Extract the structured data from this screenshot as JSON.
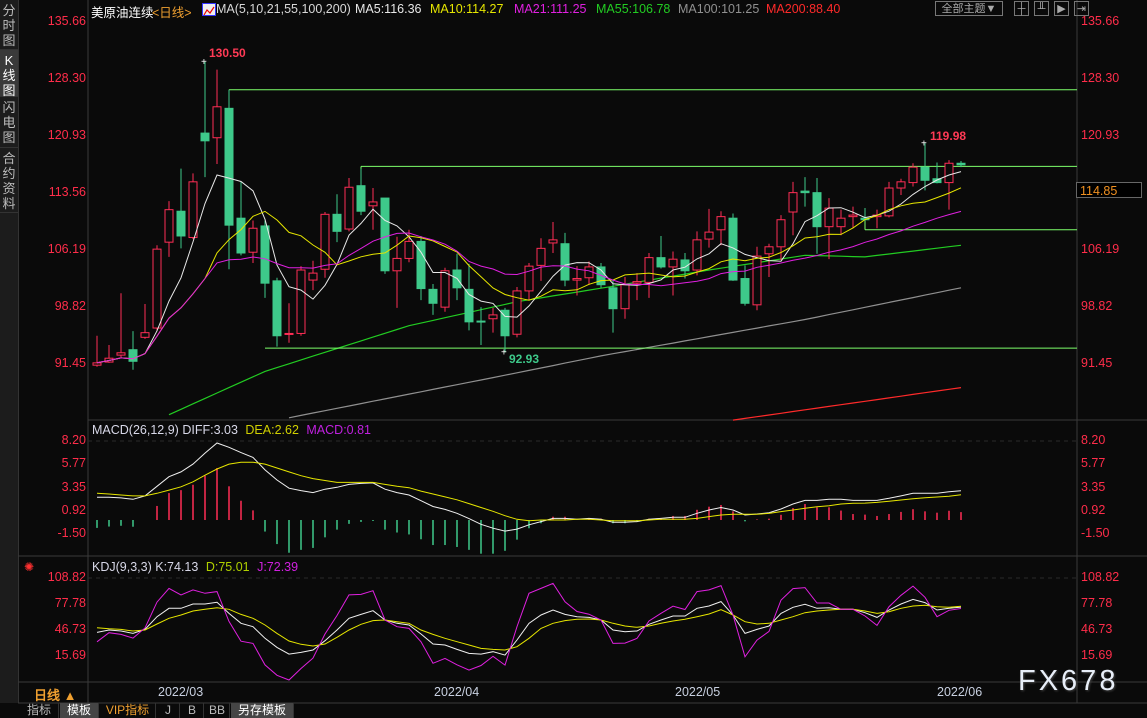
{
  "sidebar": {
    "tabs": [
      {
        "label": "分时图",
        "active": false
      },
      {
        "label": "K线图",
        "active": true
      },
      {
        "label": "闪电图",
        "active": false
      },
      {
        "label": "合约资料",
        "active": false
      }
    ]
  },
  "header": {
    "instrument": "美原油连续",
    "period": "<日线>",
    "ma_label": "MA(5,10,21,55,100,200)",
    "ma5": "MA5:116.36",
    "ma10": "MA10:114.27",
    "ma21": "MA21:111.25",
    "ma55": "MA55:106.78",
    "ma100": "MA100:101.25",
    "ma200": "MA200:88.40",
    "theme_button": "全部主题▼",
    "colors": {
      "ma5": "#e8e8e8",
      "ma10": "#e6e600",
      "ma21": "#e020e0",
      "ma55": "#22cc22",
      "ma100": "#909090",
      "ma200": "#ff2a2a"
    }
  },
  "macd_header": {
    "label": "MACD(26,12,9)",
    "diff": "DIFF:3.03",
    "dea": "DEA:2.62",
    "macd": "MACD:0.81"
  },
  "kdj_header": {
    "label": "KDJ(9,3,3)",
    "k": "K:74.13",
    "d": "D:75.01",
    "j": "J:72.39"
  },
  "price_axis": [
    "135.66",
    "128.30",
    "120.93",
    "113.56",
    "106.19",
    "98.82",
    "91.45"
  ],
  "macd_axis": [
    "8.20",
    "5.77",
    "3.35",
    "0.92",
    "-1.50"
  ],
  "kdj_axis": [
    "108.82",
    "77.78",
    "46.73",
    "15.69"
  ],
  "current_price": "114.85",
  "high_label": "130.50",
  "low_label": "92.93",
  "recent_high_label": "119.98",
  "period_selector": "日线 ▲",
  "dates": [
    "2022/03",
    "2022/04",
    "2022/05",
    "2022/06"
  ],
  "bottom_tabs": [
    {
      "label": "指标",
      "active": false
    },
    {
      "label": "模板",
      "active": true
    },
    {
      "label": "VIP指标",
      "active": false
    },
    {
      "label": "J",
      "active": false
    },
    {
      "label": "B",
      "active": false
    },
    {
      "label": "BB",
      "active": false
    },
    {
      "label": "另存模板",
      "active": true
    }
  ],
  "watermark": "FX678",
  "colors": {
    "up": "#ff2d55",
    "down": "#3ec98a",
    "annotation": "#7dff6a"
  },
  "chart_data": {
    "type": "candlestick",
    "title": "美原油连续 日线",
    "price_range": [
      91.45,
      135.66
    ],
    "ohlc": [
      [
        91.3,
        95.1,
        91.1,
        91.6
      ],
      [
        91.7,
        93.9,
        91.6,
        92.2
      ],
      [
        92.6,
        100.6,
        92.3,
        92.9
      ],
      [
        93.3,
        95.7,
        90.7,
        91.8
      ],
      [
        94.9,
        99.2,
        94.7,
        95.5
      ],
      [
        96.1,
        106.8,
        95.7,
        106.3
      ],
      [
        107.2,
        112.5,
        105.3,
        111.4
      ],
      [
        111.2,
        116.7,
        106.4,
        108.0
      ],
      [
        107.8,
        116.1,
        107.6,
        115.0
      ],
      [
        121.3,
        130.5,
        115.6,
        120.3
      ],
      [
        120.7,
        129.5,
        117.3,
        124.7
      ],
      [
        124.5,
        126.9,
        103.7,
        109.4
      ],
      [
        110.3,
        115.0,
        105.5,
        105.8
      ],
      [
        105.9,
        110.0,
        104.5,
        109.0
      ],
      [
        109.3,
        110.0,
        100.0,
        101.9
      ],
      [
        102.2,
        102.6,
        93.7,
        95.1
      ],
      [
        95.3,
        99.3,
        94.2,
        95.4
      ],
      [
        95.4,
        104.1,
        95.1,
        103.6
      ],
      [
        102.3,
        104.8,
        101.0,
        103.2
      ],
      [
        103.7,
        111.1,
        102.6,
        110.8
      ],
      [
        110.8,
        113.4,
        107.2,
        108.6
      ],
      [
        108.9,
        115.5,
        108.6,
        114.3
      ],
      [
        114.5,
        116.7,
        110.7,
        111.2
      ],
      [
        111.9,
        114.2,
        108.8,
        112.4
      ],
      [
        112.9,
        112.9,
        103.1,
        103.5
      ],
      [
        103.5,
        107.9,
        98.7,
        105.1
      ],
      [
        105.1,
        108.8,
        104.6,
        107.3
      ],
      [
        107.3,
        108.0,
        99.7,
        101.2
      ],
      [
        101.1,
        101.8,
        97.8,
        99.3
      ],
      [
        98.8,
        103.9,
        98.2,
        103.5
      ],
      [
        103.6,
        105.7,
        99.7,
        101.3
      ],
      [
        101.1,
        104.4,
        95.8,
        96.9
      ],
      [
        97.0,
        98.8,
        93.9,
        96.9
      ],
      [
        97.3,
        98.7,
        95.5,
        97.8
      ],
      [
        98.4,
        98.7,
        92.93,
        95.1
      ],
      [
        95.3,
        101.4,
        94.9,
        100.9
      ],
      [
        100.9,
        104.5,
        99.7,
        104.1
      ],
      [
        104.2,
        107.7,
        102.2,
        106.4
      ],
      [
        107.1,
        109.8,
        105.8,
        107.5
      ],
      [
        107.0,
        108.4,
        101.5,
        102.3
      ],
      [
        102.3,
        104.1,
        100.3,
        102.5
      ],
      [
        102.6,
        104.7,
        101.7,
        104.0
      ],
      [
        104.0,
        104.5,
        101.3,
        101.7
      ],
      [
        101.3,
        102.3,
        95.5,
        98.6
      ],
      [
        98.6,
        102.7,
        97.3,
        101.7
      ],
      [
        101.9,
        103.2,
        99.7,
        102.1
      ],
      [
        102.0,
        105.8,
        100.0,
        105.2
      ],
      [
        105.2,
        108.0,
        103.8,
        104.0
      ],
      [
        104.0,
        106.0,
        100.3,
        105.0
      ],
      [
        104.9,
        105.8,
        102.5,
        103.5
      ],
      [
        103.6,
        108.6,
        102.9,
        107.5
      ],
      [
        107.6,
        111.5,
        106.5,
        108.5
      ],
      [
        108.8,
        111.2,
        106.8,
        110.5
      ],
      [
        110.3,
        110.9,
        102.2,
        102.3
      ],
      [
        102.5,
        104.2,
        99.0,
        99.3
      ],
      [
        99.1,
        106.6,
        98.4,
        105.4
      ],
      [
        105.7,
        107.0,
        102.7,
        106.6
      ],
      [
        106.6,
        110.7,
        104.9,
        110.1
      ],
      [
        111.1,
        115.0,
        108.1,
        113.6
      ],
      [
        113.8,
        115.6,
        111.8,
        113.6
      ],
      [
        113.6,
        115.5,
        105.7,
        109.2
      ],
      [
        109.2,
        112.9,
        105.0,
        111.6
      ],
      [
        109.2,
        111.4,
        108.1,
        110.3
      ],
      [
        110.5,
        111.8,
        109.0,
        110.7
      ],
      [
        110.3,
        111.6,
        109.9,
        110.1
      ],
      [
        110.5,
        111.4,
        109.0,
        110.7
      ],
      [
        110.6,
        115.0,
        110.4,
        114.2
      ],
      [
        114.2,
        115.4,
        113.3,
        115.0
      ],
      [
        114.9,
        117.4,
        114.4,
        116.9
      ],
      [
        116.9,
        119.98,
        113.9,
        115.2
      ],
      [
        115.4,
        117.5,
        114.8,
        114.9
      ],
      [
        114.9,
        117.8,
        111.4,
        117.4
      ],
      [
        117.4,
        117.7,
        116.9,
        117.2
      ]
    ],
    "ma_long": {
      "ma55": [
        [
          6,
          84.9
        ],
        [
          14,
          90.5
        ],
        [
          26,
          96.4
        ],
        [
          35,
          99.5
        ],
        [
          43,
          101.5
        ],
        [
          51,
          103.6
        ],
        [
          59,
          105.5
        ],
        [
          64,
          105.3
        ],
        [
          72,
          106.8
        ]
      ],
      "ma100": [
        [
          16,
          84.5
        ],
        [
          34,
          90.0
        ],
        [
          42,
          92.5
        ],
        [
          59,
          97.2
        ],
        [
          72,
          101.3
        ]
      ],
      "ma200": [
        [
          53,
          84.2
        ],
        [
          72,
          88.4
        ]
      ]
    },
    "annotations": [
      {
        "price": 126.9,
        "from": 11
      },
      {
        "price": 117.0,
        "from": 22
      },
      {
        "price": 93.5,
        "from": 14
      },
      {
        "price": 108.8,
        "from": 64
      }
    ],
    "macd": {
      "diff": [
        2.36,
        2.36,
        2.3,
        2.15,
        2.5,
        3.5,
        4.5,
        5.0,
        5.8,
        6.95,
        8.0,
        7.55,
        7.0,
        6.5,
        5.2,
        4.15,
        3.3,
        3.05,
        2.85,
        3.2,
        3.4,
        3.7,
        3.8,
        3.85,
        3.2,
        2.85,
        2.6,
        2.0,
        1.4,
        1.1,
        0.7,
        0.15,
        -0.45,
        -0.85,
        -1.15,
        -0.95,
        -0.5,
        -0.17,
        0.17,
        0.17,
        0.07,
        0.17,
        0.07,
        -0.24,
        -0.24,
        -0.17,
        0.07,
        0.17,
        0.28,
        0.28,
        0.7,
        1.04,
        1.3,
        1.04,
        0.52,
        0.62,
        0.76,
        1.14,
        1.66,
        2.04,
        2.04,
        2.15,
        2.15,
        2.04,
        2.04,
        2.04,
        2.25,
        2.5,
        2.77,
        2.77,
        2.77,
        2.94,
        3.03
      ],
      "dea": [
        2.77,
        2.7,
        2.6,
        2.5,
        2.5,
        2.77,
        3.1,
        3.45,
        3.97,
        4.65,
        5.3,
        5.8,
        6.0,
        6.0,
        5.8,
        5.4,
        5.0,
        4.6,
        4.3,
        4.1,
        3.9,
        3.9,
        3.9,
        3.9,
        3.7,
        3.5,
        3.35,
        3.0,
        2.7,
        2.4,
        2.1,
        1.7,
        1.3,
        0.9,
        0.45,
        0.07,
        -0.07,
        0,
        0,
        0,
        0.07,
        0.07,
        0,
        -0.07,
        -0.07,
        -0.07,
        0,
        0.07,
        0.07,
        0.07,
        0.17,
        0.35,
        0.52,
        0.59,
        0.59,
        0.59,
        0.69,
        0.87,
        1.04,
        1.21,
        1.38,
        1.49,
        1.66,
        1.73,
        1.76,
        1.83,
        1.94,
        2.08,
        2.21,
        2.32,
        2.39,
        2.46,
        2.62
      ],
      "range": [
        -1.5,
        8.2
      ]
    },
    "kdj": {
      "k": [
        43.9,
        46.7,
        45.5,
        42.7,
        47.5,
        62.6,
        72.6,
        72.6,
        77.8,
        77.8,
        79.8,
        66.6,
        54.7,
        50.7,
        36.8,
        26.0,
        18.0,
        20.0,
        22.8,
        34.0,
        46.7,
        60.7,
        65.4,
        69.8,
        58.7,
        54.7,
        52.7,
        42.0,
        30.0,
        28.8,
        23.6,
        18.8,
        18.0,
        20.8,
        16.8,
        34.8,
        54.7,
        64.6,
        70.6,
        65.4,
        62.6,
        61.8,
        58.7,
        46.7,
        44.7,
        45.5,
        53.5,
        58.7,
        63.4,
        63.4,
        72.6,
        75.4,
        80.6,
        64.6,
        42.7,
        47.5,
        51.5,
        66.6,
        73.8,
        77.4,
        72.6,
        73.4,
        71.4,
        71.4,
        67.4,
        61.8,
        70.6,
        77.8,
        83.3,
        79.4,
        70.6,
        72.6,
        74.13
      ],
      "d": [
        49.5,
        48.3,
        47.5,
        45.5,
        46.7,
        53.9,
        60.7,
        64.6,
        69.4,
        71.4,
        73.4,
        71.4,
        65.4,
        60.7,
        52.7,
        42.7,
        33.6,
        29.6,
        27.6,
        30.0,
        38.0,
        46.7,
        53.5,
        57.9,
        58.7,
        56.7,
        54.7,
        46.7,
        41.5,
        36.8,
        32.8,
        28.8,
        24.8,
        23.6,
        22.8,
        26.8,
        36.8,
        48.7,
        54.7,
        57.9,
        59.5,
        59.9,
        58.7,
        54.7,
        51.5,
        49.9,
        51.5,
        54.7,
        57.5,
        59.5,
        62.6,
        65.8,
        71.0,
        64.6,
        56.7,
        53.9,
        54.7,
        58.7,
        62.6,
        67.4,
        69.4,
        70.6,
        71.4,
        71.4,
        69.4,
        66.6,
        68.6,
        72.6,
        75.4,
        76.2,
        74.6,
        73.8,
        75.01
      ],
      "range": [
        15.69,
        108.82
      ]
    }
  }
}
